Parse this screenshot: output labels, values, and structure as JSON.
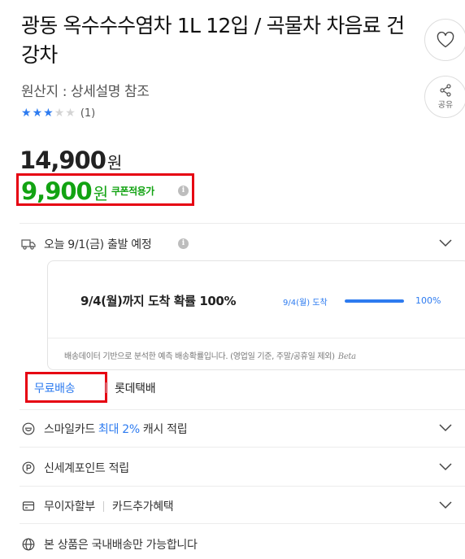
{
  "product": {
    "title": "광동 옥수수수염차 1L 12입 / 곡물차 차음료 건강차",
    "origin": "원산지 : 상세설명 참조",
    "rating": 3,
    "rating_max": 5,
    "review_count": "(1)"
  },
  "actions": {
    "favorite_icon": "heart-icon",
    "share_icon": "share-icon",
    "share_label": "공유"
  },
  "price": {
    "original": "14,900",
    "original_unit": "원",
    "coupon": "9,900",
    "coupon_unit": "원",
    "coupon_tag": "쿠폰적용가",
    "info_glyph": "i"
  },
  "delivery": {
    "schedule": "오늘 9/1(금) 출발 예정",
    "info_glyph": "i",
    "probability_title": "9/4(월)까지 도착 확률 100%",
    "probability_date": "9/4(월) 도착",
    "probability_value": 100,
    "probability_pct": "100%",
    "note": "배송데이터 기반으로 분석한 예측 배송확률입니다. (영업일 기준, 주말/공휴일 제외)",
    "beta": "Beta",
    "shipping_free": "무료배송",
    "courier": "롯데택배"
  },
  "benefits": {
    "smile_prefix": "스마일카드",
    "smile_highlight": "최대 2%",
    "smile_suffix": "캐시 적립",
    "shinsegae": "신세계포인트 적립",
    "installment": "무이자할부",
    "card_benefit": "카드추가혜택",
    "domestic": "본 상품은 국내배송만 가능합니다"
  },
  "colors": {
    "accent_blue": "#2d7bf0",
    "coupon_green": "#12a312",
    "highlight_red": "#e60012"
  }
}
